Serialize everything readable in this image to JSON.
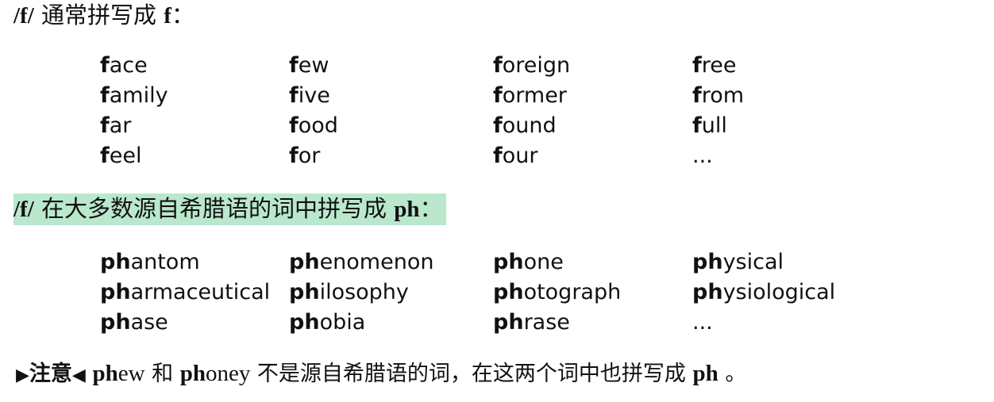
{
  "section_f": {
    "heading": {
      "code": "/f/",
      "text": " 通常拼写成 ",
      "letters": "f",
      "colon": "："
    },
    "rows": [
      [
        {
          "prefix": "f",
          "rest": "ace"
        },
        {
          "prefix": "f",
          "rest": "ew"
        },
        {
          "prefix": "f",
          "rest": "oreign"
        },
        {
          "prefix": "f",
          "rest": "ree"
        }
      ],
      [
        {
          "prefix": "f",
          "rest": "amily"
        },
        {
          "prefix": "f",
          "rest": "ive"
        },
        {
          "prefix": "f",
          "rest": "ormer"
        },
        {
          "prefix": "f",
          "rest": "rom"
        }
      ],
      [
        {
          "prefix": "f",
          "rest": "ar"
        },
        {
          "prefix": "f",
          "rest": "ood"
        },
        {
          "prefix": "f",
          "rest": "ound"
        },
        {
          "prefix": "f",
          "rest": "ull"
        }
      ],
      [
        {
          "prefix": "f",
          "rest": "eel"
        },
        {
          "prefix": "f",
          "rest": "or"
        },
        {
          "prefix": "f",
          "rest": "our"
        },
        {
          "prefix": "",
          "rest": "..."
        }
      ]
    ]
  },
  "section_ph": {
    "heading": {
      "code": "/f/",
      "text": " 在大多数源自希腊语的词中拼写成 ",
      "letters": "ph",
      "colon": "："
    },
    "highlight_color": "#b9e8cc",
    "rows": [
      [
        {
          "prefix": "ph",
          "rest": "antom"
        },
        {
          "prefix": "ph",
          "rest": "enomenon"
        },
        {
          "prefix": "ph",
          "rest": "one"
        },
        {
          "prefix": "ph",
          "rest": "ysical"
        }
      ],
      [
        {
          "prefix": "ph",
          "rest": "armaceutical"
        },
        {
          "prefix": "ph",
          "rest": "ilosophy"
        },
        {
          "prefix": "ph",
          "rest": "otograph"
        },
        {
          "prefix": "ph",
          "rest": "ysiological"
        }
      ],
      [
        {
          "prefix": "ph",
          "rest": "ase"
        },
        {
          "prefix": "ph",
          "rest": "obia"
        },
        {
          "prefix": "ph",
          "rest": "rase"
        },
        {
          "prefix": "",
          "rest": "..."
        }
      ]
    ]
  },
  "note": {
    "marker_left": "▶",
    "label": "注意",
    "marker_right": "◀",
    "word1_prefix": "ph",
    "word1_rest": "ew",
    "and": " 和 ",
    "word2_prefix": "ph",
    "word2_rest": "oney",
    "text": " 不是源自希腊语的词，在这两个词中也拼写成 ",
    "letters": "ph",
    "end": " 。"
  }
}
